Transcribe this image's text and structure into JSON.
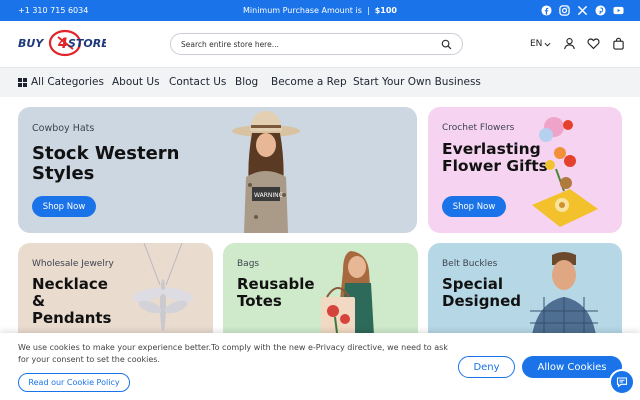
{
  "topbar": {
    "phone": "+1 310 715 6034",
    "promo_label": "Minimum Purchase Amount is",
    "promo_value": "$100",
    "socials": [
      "facebook-icon",
      "instagram-icon",
      "x-icon",
      "pinterest-icon",
      "youtube-icon"
    ]
  },
  "header": {
    "logo_text": "BUY4STORE",
    "search_placeholder": "Search entire store here...",
    "language": "EN"
  },
  "nav": {
    "items": [
      "All Categories",
      "About Us",
      "Contact Us",
      "Blog",
      "Become a Rep",
      "Start Your Own Business"
    ]
  },
  "cards": [
    {
      "eyebrow": "Cowboy Hats",
      "title": "Stock Western\nStyles",
      "button": "Shop Now"
    },
    {
      "eyebrow": "Crochet Flowers",
      "title": "Everlasting\nFlower Gifts",
      "button": "Shop Now"
    },
    {
      "eyebrow": "Wholesale Jewelry",
      "title": "Necklace\n&\nPendants"
    },
    {
      "eyebrow": "Bags",
      "title": "Reusable\nTotes"
    },
    {
      "eyebrow": "Belt Buckles",
      "title": "Special\nDesigned"
    }
  ],
  "cookie": {
    "message": "We use cookies to make your experience better.To comply with the new e-Privacy directive, we need to ask for your consent to set the cookies.",
    "policy_label": "Read our Cookie Policy",
    "deny_label": "Deny",
    "allow_label": "Allow Cookies"
  },
  "colors": {
    "brand_blue": "#1a73e8",
    "logo_red": "#e0262b",
    "logo_navy": "#1f3a7a"
  }
}
